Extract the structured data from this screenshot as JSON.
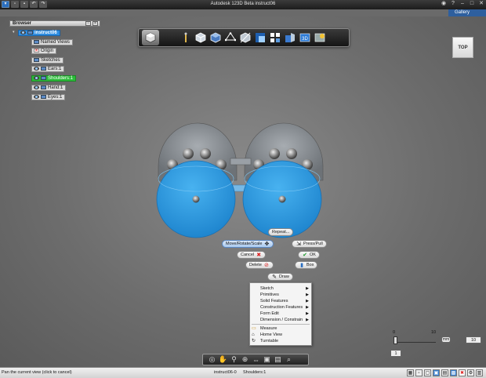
{
  "titlebar": {
    "title": "Autodesk 123D Beta    instruct06"
  },
  "gallery": {
    "label": "Gallery"
  },
  "browser": {
    "header": "Browser",
    "root": "instruct06",
    "items": [
      {
        "label": "Named Views"
      },
      {
        "label": "Origin"
      },
      {
        "label": "Sketches"
      },
      {
        "label": "Ears:1"
      },
      {
        "label": "Shoulders:1"
      },
      {
        "label": "Hand:1"
      },
      {
        "label": "Eyes:1"
      }
    ]
  },
  "viewcube": {
    "face": "TOP"
  },
  "toolbar": {
    "tools": [
      "app-logo",
      "transform-tool",
      "primitive-box",
      "primitive-cylinder",
      "sketch-tool",
      "construct-tool",
      "modify-tool",
      "pattern-tool",
      "group-tool",
      "3d-print",
      "materials"
    ]
  },
  "marking_menu": {
    "repeat": "Repeat...",
    "move": "Move/Rotate/Scale",
    "presspull": "Press/Pull",
    "cancel": "Cancel",
    "ok": "OK",
    "delete": "Delete",
    "box": "Box",
    "draw": "Draw"
  },
  "context_menu": {
    "items": [
      {
        "label": "Sketch",
        "submenu": true
      },
      {
        "label": "Primitives",
        "submenu": true
      },
      {
        "label": "Solid Features",
        "submenu": true
      },
      {
        "label": "Construction Features",
        "submenu": true
      },
      {
        "label": "Form Edit",
        "submenu": true
      },
      {
        "label": "Dimension / Constrain",
        "submenu": true
      },
      {
        "label": "Measure",
        "submenu": false
      },
      {
        "label": "Home View",
        "submenu": false
      },
      {
        "label": "Turntable",
        "submenu": false
      }
    ]
  },
  "grid": {
    "tick_0": "0",
    "tick_10": "10",
    "unit": "mm",
    "value": "10",
    "low": "1"
  },
  "status": {
    "hint": "Pan the current view (click to cancel)",
    "document": "instruct06-0",
    "selection": "Shoulders:1"
  },
  "colors": {
    "selection_blue": "#2f8de0",
    "model_blue": "#2e9be3",
    "model_gray": "#8a8f94"
  }
}
